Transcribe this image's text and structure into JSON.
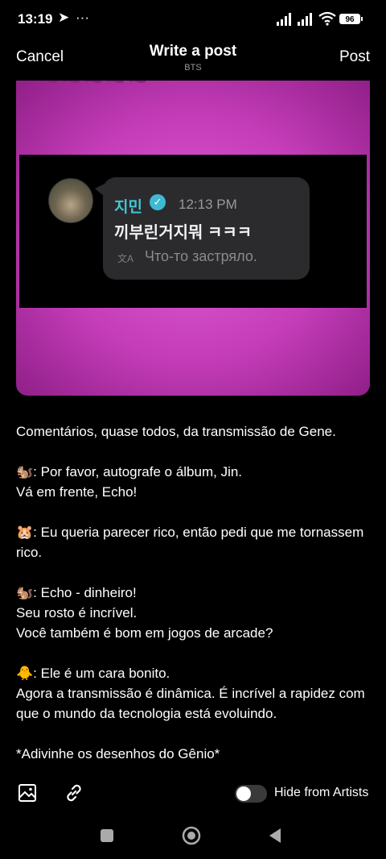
{
  "status_bar": {
    "time": "13:19",
    "telegram_icon": "telegram-icon",
    "more": "···",
    "battery": "96"
  },
  "header": {
    "cancel_label": "Cancel",
    "title": "Write a post",
    "subtitle": "BTS",
    "post_label": "Post"
  },
  "media": {
    "chat": {
      "sender": "지민",
      "time": "12:13 PM",
      "message": "끼부린거지뭐 ㅋㅋㅋ",
      "translation": "Что-то застряло."
    }
  },
  "post_body": [
    "Comentários, quase todos, da transmissão de Gene.",
    "",
    "🐿️: Por favor, autografe o álbum, Jin.",
    "Vá em frente, Echo!",
    "",
    "🐹: Eu queria parecer rico, então pedi que me tornassem rico.",
    "",
    "🐿️: Echo - dinheiro!",
    "Seu rosto é incrível.",
    "Você também é bom em jogos de arcade?",
    "",
    "🐥: Ele é um cara bonito.",
    "Agora a transmissão é dinâmica. É incrível a rapidez com que o mundo da tecnologia está evoluindo.",
    "",
    "*Adivinhe os desenhos do Gênio*"
  ],
  "toolbar": {
    "hide_label": "Hide from Artists",
    "hide_enabled": false
  }
}
